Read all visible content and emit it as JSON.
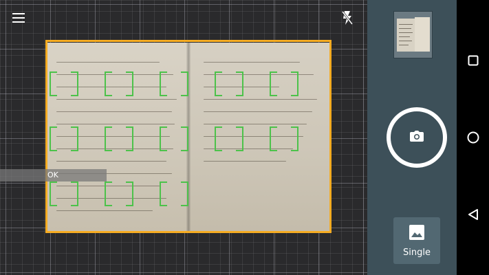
{
  "viewfinder": {
    "menu_icon": "hamburger-menu-icon",
    "flash_icon": "flash-off-icon",
    "status_text": "OK",
    "colors": {
      "document_border": "#f6ac22",
      "focus_marks": "#4cc24a",
      "background": "#2a2a2c"
    }
  },
  "controls": {
    "thumbnail_icon": "last-scan-thumbnail",
    "shutter_icon": "camera-icon",
    "mode": {
      "icon": "image-icon",
      "label": "Single"
    },
    "colors": {
      "panel": "#3d5059",
      "mode_button": "#526872"
    }
  },
  "navbar": {
    "recents_icon": "square-recents-icon",
    "home_icon": "circle-home-icon",
    "back_icon": "triangle-back-icon"
  }
}
